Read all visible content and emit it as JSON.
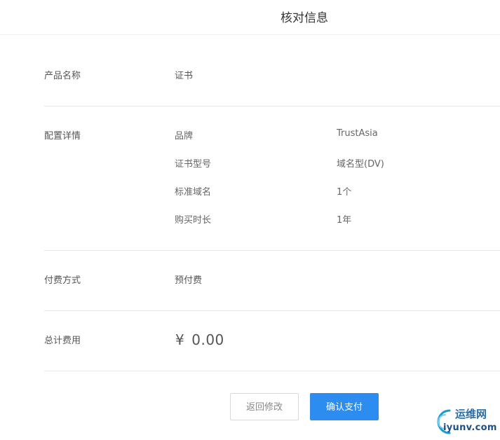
{
  "header": {
    "title": "核对信息"
  },
  "product": {
    "label": "产品名称",
    "value": "证书"
  },
  "config": {
    "label": "配置详情",
    "items": [
      {
        "key": "品牌",
        "value": "TrustAsia"
      },
      {
        "key": "证书型号",
        "value": "域名型(DV)"
      },
      {
        "key": "标准域名",
        "value": "1个"
      },
      {
        "key": "购买时长",
        "value": "1年"
      }
    ]
  },
  "payment": {
    "label": "付费方式",
    "value": "预付费"
  },
  "total": {
    "label": "总计费用",
    "currency": "¥",
    "amount": "0.00"
  },
  "actions": {
    "back_label": "返回修改",
    "pay_label": "确认支付"
  },
  "watermark": {
    "line1": "运维网",
    "line2": "iyunv.com"
  }
}
